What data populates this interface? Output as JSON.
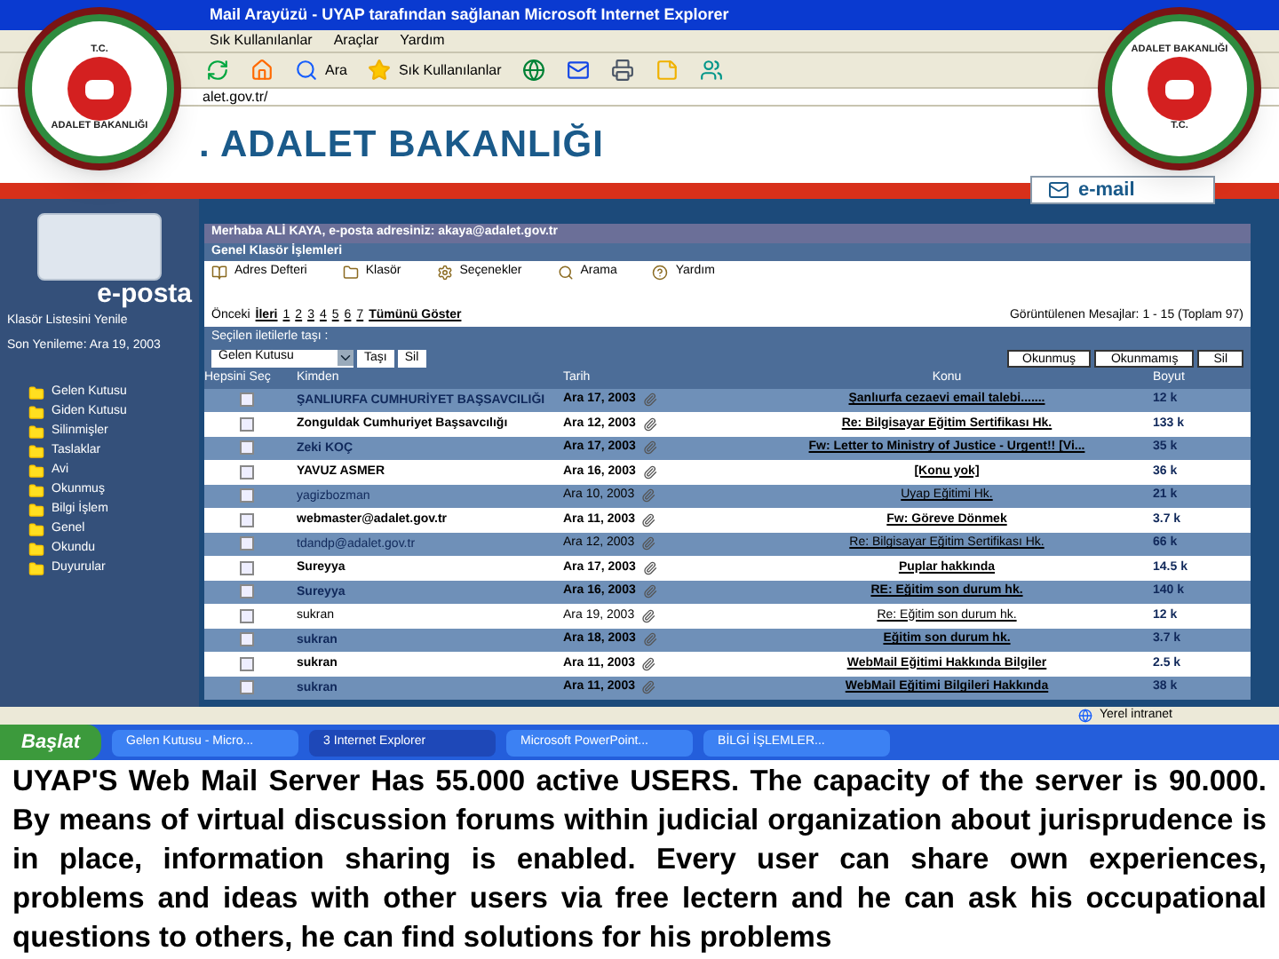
{
  "window": {
    "title": "Mail Arayüzü - UYAP tarafından sağlanan Microsoft Internet Explorer"
  },
  "menu": [
    "Sık Kullanılanlar",
    "Araçlar",
    "Yardım"
  ],
  "toolbar": [
    "Ara",
    "Sık Kullanılanlar"
  ],
  "address": "alet.gov.tr/",
  "logos": [
    {
      "top": "T.C.",
      "bottom": "ADALET BAKANLIĞI"
    },
    {
      "top": "ADALET BAKANLIĞI",
      "bottom": "T.C."
    }
  ],
  "banner": {
    "title": ". ADALET BAKANLIĞI",
    "email_button": "e-mail"
  },
  "sidebar": {
    "brand": "e-posta",
    "info": [
      "Klasör Listesini Yenile",
      "Son Yenileme: Ara 19, 2003"
    ],
    "folders": [
      "Gelen Kutusu",
      "Giden Kutusu",
      "Silinmişler",
      "Taslaklar",
      "Avi",
      "Okunmuş",
      "Bilgi İşlem",
      "Genel",
      "Okundu",
      "Duyurular"
    ]
  },
  "greeting": "Merhaba ALİ KAYA, e-posta adresiniz: akaya@adalet.gov.tr",
  "section_title": "Genel Klasör İşlemleri",
  "actions": [
    "Adres Defteri",
    "Klasör",
    "Seçenekler",
    "Arama",
    "Yardım"
  ],
  "pager": {
    "prev": "Önceki",
    "next": "İleri",
    "pages": [
      "1",
      "2",
      "3",
      "4",
      "5",
      "6",
      "7"
    ],
    "all": "Tümünü Göster",
    "summary": "Görüntülenen Mesajlar: 1 - 15 (Toplam 97)"
  },
  "move": {
    "label": "Seçilen iletilerle taşı :",
    "folder": "Gelen Kutusu",
    "buttons": [
      "Taşı",
      "Sil"
    ]
  },
  "mark_buttons": [
    "Okunmuş",
    "Okunmamış",
    "Sil"
  ],
  "columns": [
    "Hepsini Seç",
    "Kimden",
    "Tarih",
    "Konu",
    "Boyut"
  ],
  "rows": [
    {
      "from": "ŞANLIURFA CUMHURİYET BAŞSAVCILIĞI",
      "date": "Ara 17, 2003",
      "subject": "Şanlıurfa cezaevi email talebi.......",
      "size": "12 k",
      "unread": true,
      "checked": false
    },
    {
      "from": "Zonguldak Cumhuriyet Başsavcılığı",
      "date": "Ara 12, 2003",
      "subject": "Re: Bilgisayar Eğitim Sertifikası Hk.",
      "size": "133 k",
      "unread": true,
      "checked": false
    },
    {
      "from": "Zeki KOÇ",
      "date": "Ara 17, 2003",
      "subject": "Fw: Letter to Ministry of Justice - Urgent!! [Vi...",
      "size": "35 k",
      "unread": true,
      "checked": false
    },
    {
      "from": "YAVUZ ASMER",
      "date": "Ara 16, 2003",
      "subject": "[Konu yok]",
      "size": "36 k",
      "unread": true,
      "checked": false
    },
    {
      "from": "yagizbozman",
      "date": "Ara 10, 2003",
      "subject": "Uyap Eğitimi Hk.",
      "size": "21 k",
      "unread": false,
      "checked": false
    },
    {
      "from": "webmaster@adalet.gov.tr",
      "date": "Ara 11, 2003",
      "subject": "Fw: Göreve Dönmek",
      "size": "3.7 k",
      "unread": true,
      "checked": false
    },
    {
      "from": "tdandp@adalet.gov.tr",
      "date": "Ara 12, 2003",
      "subject": "Re: Bilgisayar Eğitim Sertifikası Hk.",
      "size": "66 k",
      "unread": false,
      "checked": false
    },
    {
      "from": "Sureyya",
      "date": "Ara 17, 2003",
      "subject": "Puplar hakkında",
      "size": "14.5 k",
      "unread": true,
      "checked": false
    },
    {
      "from": "Sureyya",
      "date": "Ara 16, 2003",
      "subject": "RE: Eğitim son durum hk.",
      "size": "140 k",
      "unread": true,
      "checked": false
    },
    {
      "from": "sukran",
      "date": "Ara 19, 2003",
      "subject": "Re: Eğitim son durum hk.",
      "size": "12 k",
      "unread": false,
      "checked": false
    },
    {
      "from": "sukran",
      "date": "Ara 18, 2003",
      "subject": "Eğitim son durum hk.",
      "size": "3.7 k",
      "unread": true,
      "checked": false
    },
    {
      "from": "sukran",
      "date": "Ara 11, 2003",
      "subject": "WebMail Eğitimi Hakkında Bilgiler",
      "size": "2.5 k",
      "unread": true,
      "checked": false
    },
    {
      "from": "sukran",
      "date": "Ara 11, 2003",
      "subject": "WebMail Eğitimi Bilgileri Hakkında",
      "size": "38 k",
      "unread": true,
      "checked": false
    }
  ],
  "status_bar": {
    "zone": "Yerel intranet"
  },
  "taskbar": {
    "start": "Başlat",
    "tasks": [
      "Gelen Kutusu - Micro...",
      "3 Internet Explorer",
      "Microsoft PowerPoint...",
      "BİLGİ İŞLEMLER..."
    ]
  },
  "caption": "UYAP'S Web Mail Server Has 55.000 active USERS. The capacity of the server is 90.000. By means of virtual discussion forums within judicial organization about jurisprudence is in place, information sharing is enabled. Every user can share own experiences, problems and ideas with other users via free lectern and he can ask  his occupational questions to others, he can find solutions for his problems"
}
